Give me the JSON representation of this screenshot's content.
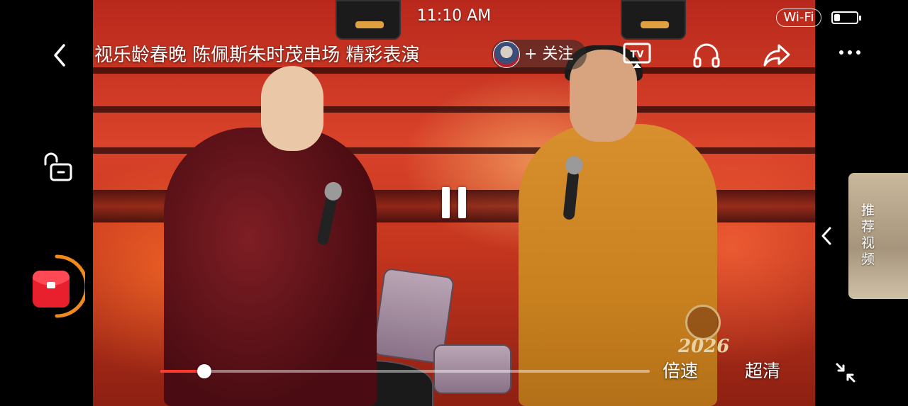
{
  "status_bar": {
    "time": "11:10 AM",
    "wifi": "Wi-Fi",
    "battery_level": 0.25
  },
  "header": {
    "title": "视乐龄春晚 陈佩斯朱时茂串场 精彩表演",
    "follow_label": "+ 关注",
    "icons": [
      "back-icon",
      "tv-cast-icon",
      "headphones-icon",
      "share-icon",
      "more-icon"
    ],
    "tv_label": "TV"
  },
  "side": {
    "lock_icon": "unlock-icon",
    "red_envelope_icon": "red-envelope-icon",
    "recommend_label": "推荐视频"
  },
  "video": {
    "watermark_year": "2026"
  },
  "controls": {
    "progress": 0.09,
    "speed_label": "倍速",
    "quality_label": "超清",
    "exit_fullscreen_icon": "exit-fullscreen-icon",
    "pause_icon": "pause-icon"
  },
  "colors": {
    "progress": "#ff3b30",
    "timer_ring": "#f08a1c",
    "red_envelope": "#e8202e"
  }
}
